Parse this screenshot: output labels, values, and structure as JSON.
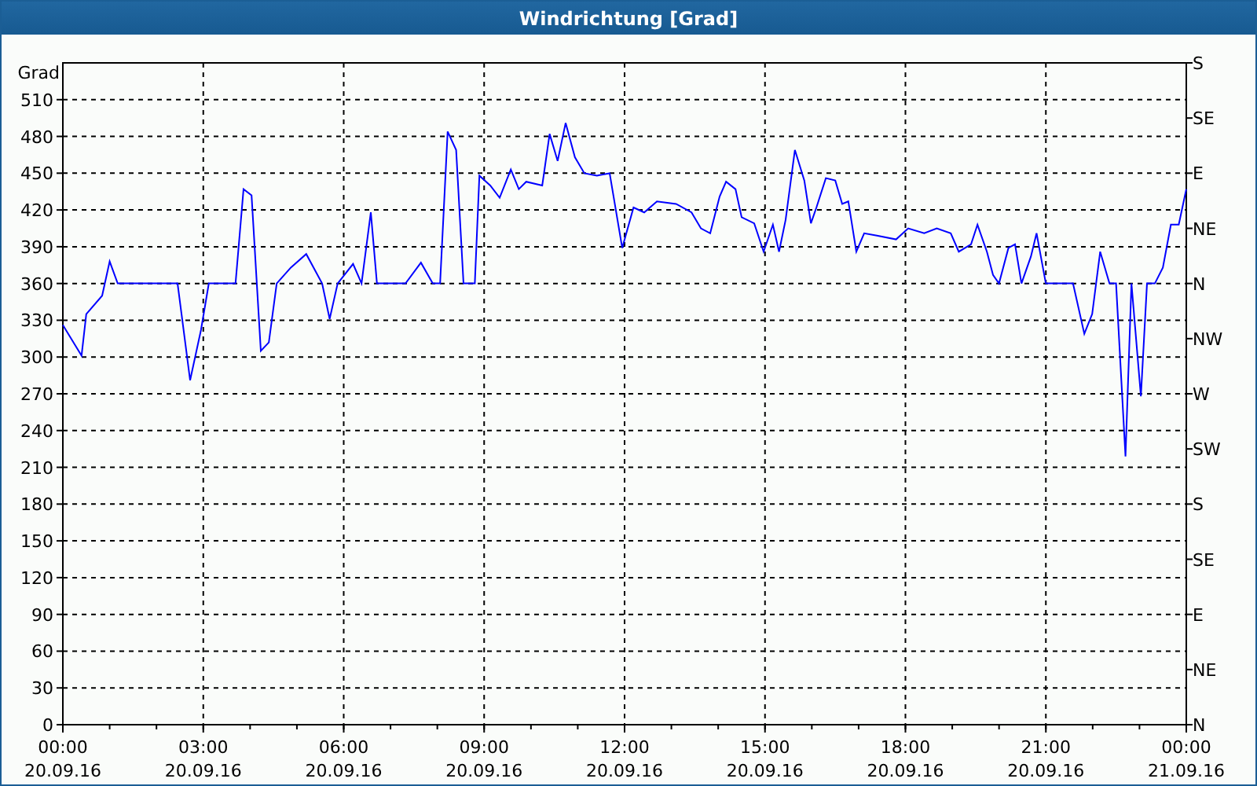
{
  "window": {
    "title": "Windrichtung [Grad]"
  },
  "chart": {
    "direction_labels": [
      "S",
      "SE",
      "E",
      "NE",
      "N",
      "NW",
      "W",
      "SW",
      "S",
      "SE",
      "E",
      "NE",
      "N"
    ],
    "date_labels": [
      "20.09.16",
      "20.09.16",
      "20.09.16",
      "20.09.16",
      "20.09.16",
      "20.09.16",
      "20.09.16",
      "20.09.16",
      "21.09.16"
    ],
    "chart_data": {
      "type": "line",
      "grid": true,
      "ylabel": "Grad",
      "xlim": [
        0,
        24
      ],
      "ylim": [
        0,
        540
      ],
      "yticks": [
        0,
        30,
        60,
        90,
        120,
        150,
        180,
        210,
        240,
        270,
        300,
        330,
        360,
        390,
        420,
        450,
        480,
        510
      ],
      "xticks": [
        {
          "value": 0,
          "label": "00:00"
        },
        {
          "value": 3,
          "label": "03:00"
        },
        {
          "value": 6,
          "label": "06:00"
        },
        {
          "value": 9,
          "label": "09:00"
        },
        {
          "value": 12,
          "label": "12:00"
        },
        {
          "value": 15,
          "label": "15:00"
        },
        {
          "value": 18,
          "label": "18:00"
        },
        {
          "value": 21,
          "label": "21:00"
        },
        {
          "value": 24,
          "label": "00:00"
        }
      ],
      "x": [
        0,
        0.4,
        0.5,
        0.84,
        1.0,
        1.17,
        2.45,
        2.72,
        2.95,
        3.12,
        3.69,
        3.86,
        4.03,
        4.23,
        4.4,
        4.57,
        4.87,
        5.2,
        5.54,
        5.7,
        5.87,
        6.2,
        6.38,
        6.58,
        6.71,
        7.32,
        7.65,
        7.9,
        8.06,
        8.22,
        8.4,
        8.56,
        8.8,
        8.9,
        9.13,
        9.33,
        9.57,
        9.74,
        9.9,
        10.24,
        10.4,
        10.57,
        10.74,
        10.94,
        11.14,
        11.41,
        11.68,
        11.95,
        12.19,
        12.42,
        12.69,
        13.1,
        13.43,
        13.63,
        13.83,
        14.03,
        14.17,
        14.37,
        14.5,
        14.77,
        14.97,
        15.17,
        15.3,
        15.44,
        15.64,
        15.84,
        15.98,
        16.1,
        16.3,
        16.5,
        16.65,
        16.78,
        16.95,
        17.12,
        17.39,
        17.8,
        18.06,
        18.4,
        18.67,
        18.97,
        19.14,
        19.4,
        19.54,
        19.74,
        19.87,
        20.0,
        20.2,
        20.34,
        20.48,
        20.68,
        20.8,
        21.0,
        21.58,
        21.82,
        21.99,
        22.16,
        22.36,
        22.5,
        22.7,
        22.83,
        23.03,
        23.16,
        23.33,
        23.5,
        23.67,
        23.84,
        24
      ],
      "series": [
        {
          "color": "#0000ff",
          "values": [
            326,
            301,
            335,
            350,
            378,
            360,
            360,
            281,
            322,
            360,
            360,
            437,
            432,
            305,
            312,
            360,
            373,
            384,
            360,
            331,
            360,
            376,
            360,
            418,
            360,
            360,
            377,
            360,
            360,
            484,
            469,
            360,
            360,
            448,
            440,
            430,
            453,
            437,
            443,
            440,
            482,
            460,
            491,
            463,
            450,
            448,
            450,
            389,
            422,
            418,
            427,
            425,
            418,
            405,
            401,
            431,
            443,
            437,
            414,
            409,
            386,
            408,
            386,
            412,
            469,
            444,
            409,
            422,
            446,
            444,
            425,
            427,
            386,
            401,
            399,
            396,
            405,
            401,
            405,
            401,
            386,
            392,
            408,
            386,
            367,
            360,
            389,
            392,
            360,
            382,
            401,
            360,
            360,
            319,
            335,
            386,
            360,
            360,
            219,
            360,
            268,
            360,
            360,
            373,
            408,
            408,
            437
          ]
        }
      ]
    }
  }
}
